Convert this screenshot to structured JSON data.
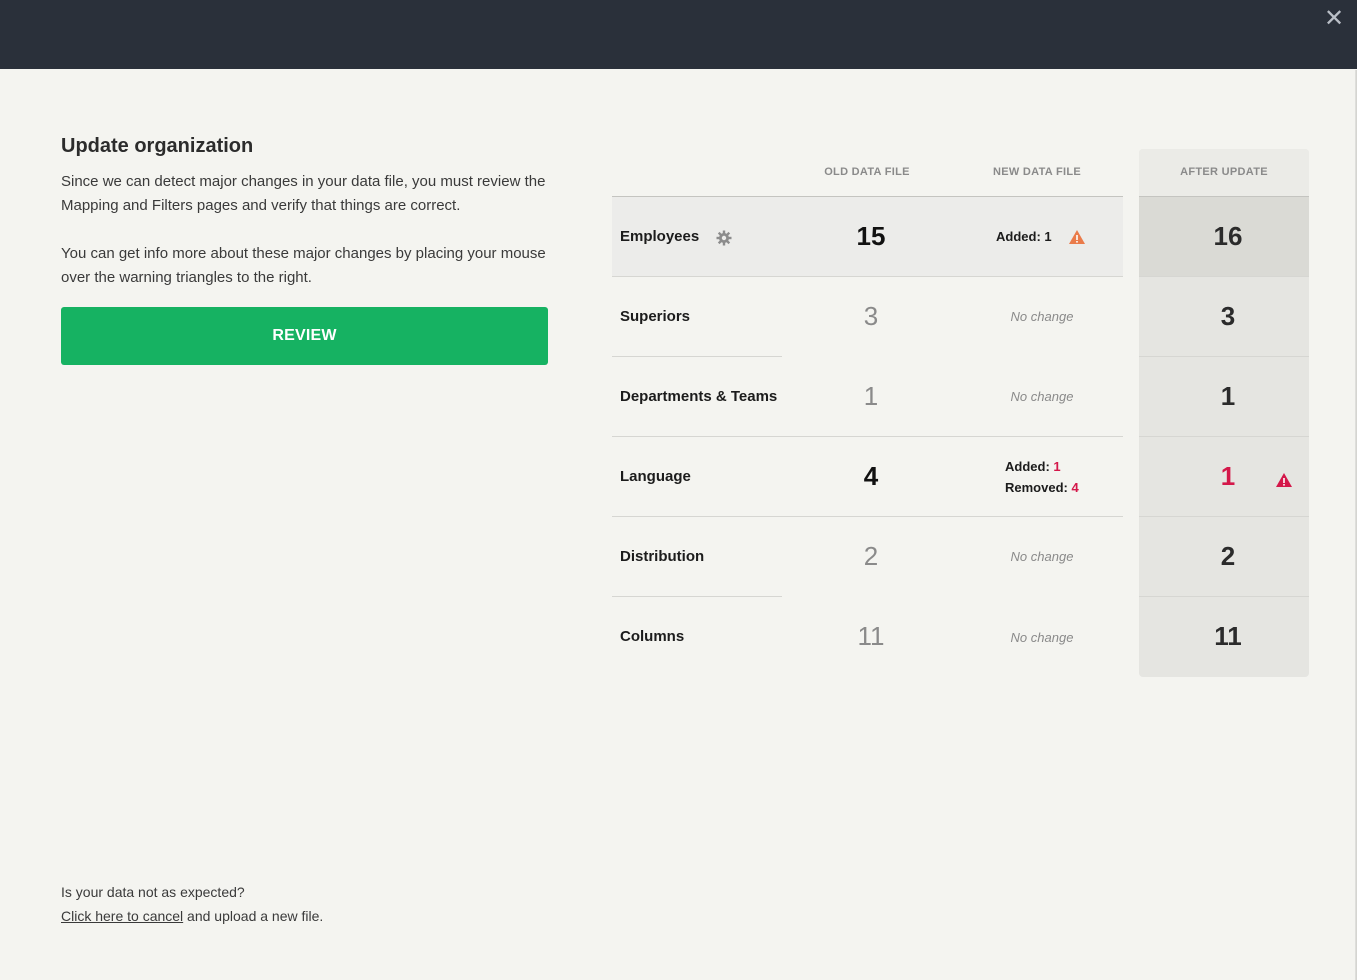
{
  "window": {
    "close_glyph": "✕"
  },
  "left": {
    "title": "Update organization",
    "paragraph1": "Since we can detect major changes in your data file, you must review the Mapping and Filters pages and verify that things are correct.",
    "paragraph2": "You can get info more about these major changes by placing your mouse over the warning triangles to the right.",
    "review_label": "REVIEW"
  },
  "table": {
    "headers": {
      "old": "OLD DATA FILE",
      "new": "NEW DATA FILE",
      "after": "AFTER UPDATE"
    },
    "rows": [
      {
        "label": "Employees",
        "old": "15",
        "new_added_label": "Added: ",
        "new_added": "1",
        "after": "16"
      },
      {
        "label": "Superiors",
        "old": "3",
        "new": "No change",
        "after": "3"
      },
      {
        "label": "Departments & Teams",
        "old": "1",
        "new": "No change",
        "after": "1"
      },
      {
        "label": "Language",
        "old": "4",
        "new_added_label": "Added: ",
        "new_added": "1",
        "new_removed_label": "Removed: ",
        "new_removed": "4",
        "after": "1"
      },
      {
        "label": "Distribution",
        "old": "2",
        "new": "No change",
        "after": "2"
      },
      {
        "label": "Columns",
        "old": "11",
        "new": "No change",
        "after": "11"
      }
    ]
  },
  "colors": {
    "accent_green": "#16b262",
    "warning_orange": "#ea7b4a",
    "error_red": "#d4184a",
    "topbar": "#2a303a"
  },
  "footer": {
    "question": "Is your data not as expected?",
    "cancel_link": "Click here to cancel",
    "rest": " and upload a new file."
  }
}
